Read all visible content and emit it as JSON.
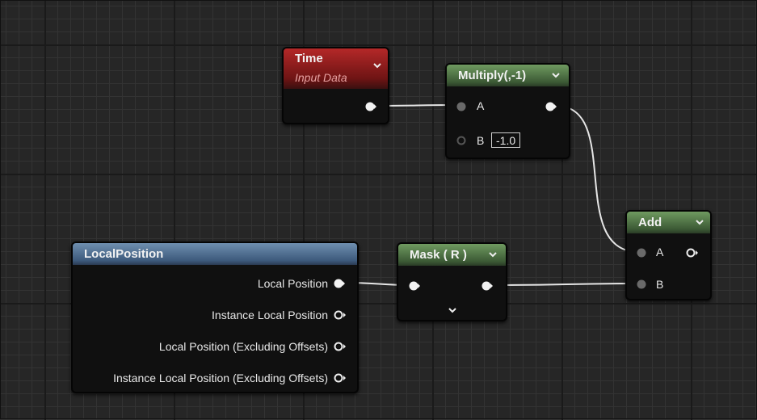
{
  "nodes": {
    "time": {
      "title": "Time",
      "subtitle": "Input Data"
    },
    "multiply": {
      "title": "Multiply(,-1)",
      "pin_a": "A",
      "pin_b": "B",
      "b_value": "-1.0"
    },
    "add": {
      "title": "Add",
      "pin_a": "A",
      "pin_b": "B"
    },
    "local_position": {
      "title": "LocalPosition",
      "outputs": [
        "Local Position",
        "Instance Local Position",
        "Local Position (Excluding Offsets)",
        "Instance Local Position (Excluding Offsets)"
      ]
    },
    "mask": {
      "title": "Mask ( R )"
    }
  },
  "icons": {
    "collapse": "chevron-down-icon",
    "pin_connected": "filled-pin-icon",
    "pin_unconnected": "hollow-pin-icon"
  },
  "colors": {
    "time_header": "#9a1f1f",
    "math_header": "#4f7345",
    "input_header": "#56759a",
    "wire": "#e6e6e6",
    "background": "#262626"
  }
}
